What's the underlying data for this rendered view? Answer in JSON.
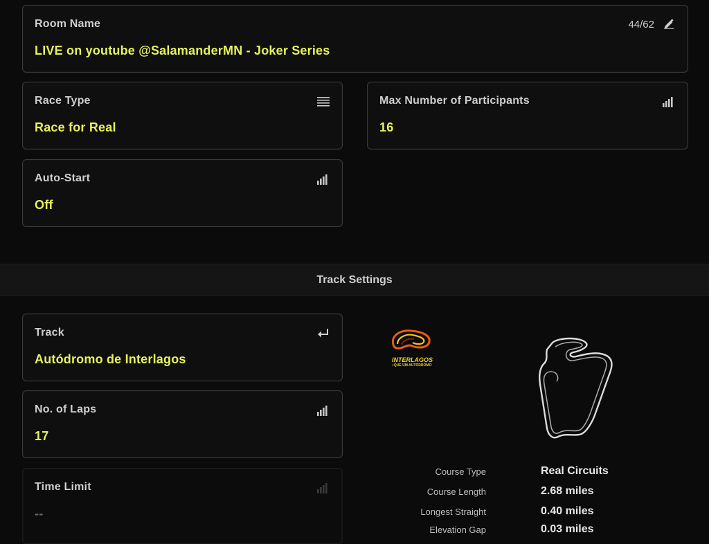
{
  "room": {
    "label": "Room Name",
    "value": "LIVE on youtube @SalamanderMN - Joker Series",
    "counter": "44/62"
  },
  "race_type": {
    "label": "Race Type",
    "value": "Race for Real"
  },
  "max_participants": {
    "label": "Max Number of Participants",
    "value": "16"
  },
  "auto_start": {
    "label": "Auto-Start",
    "value": "Off"
  },
  "section": {
    "title": "Track Settings"
  },
  "track": {
    "label": "Track",
    "value": "Autódromo de Interlagos",
    "logo_text": "INTERLAGOS",
    "logo_subtext": "+QUE UM AUTÓDROMO"
  },
  "laps": {
    "label": "No. of Laps",
    "value": "17"
  },
  "time_limit": {
    "label": "Time Limit",
    "value": "--"
  },
  "course_info": [
    {
      "key": "Course Type",
      "value": "Real Circuits"
    },
    {
      "key": "Course Length",
      "value": "2.68 miles"
    },
    {
      "key": "Longest Straight",
      "value": "0.40 miles"
    },
    {
      "key": "Elevation Gap",
      "value": "0.03 miles"
    }
  ],
  "colors": {
    "accent": "#e6f25c",
    "background": "#0b0b0b",
    "panel_border": "#3a3a3a"
  }
}
